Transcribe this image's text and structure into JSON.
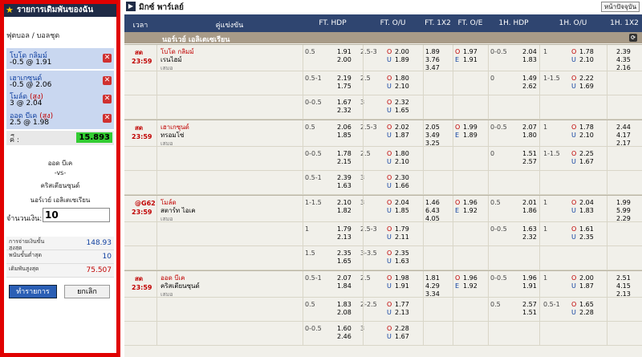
{
  "slip": {
    "header": "รายการเดิมพันของฉัน",
    "bet_type": "ฟุตบอล / บอลชุด",
    "selections": [
      {
        "team": "โบโด กลิมม์",
        "side": "",
        "odds_text": "-0.5 @ 1.91"
      },
      {
        "team": "เฮาเกซุนด์",
        "side": "",
        "odds_text": "-0.5 @ 2.06"
      },
      {
        "team": "โมล์ด",
        "side": "(สูง)",
        "odds_text": "3 @ 2.04"
      },
      {
        "team": "ออด บีเค",
        "side": "(สูง)",
        "odds_text": "2.5 @ 1.98"
      }
    ],
    "total_label": "ค่ี :",
    "total_value": "15.893",
    "match_home": "ออด บีเค",
    "match_vs": "-vs-",
    "match_away": "คริสเตียนซุนด์",
    "match_league": "นอร์เวย์ เอลิเตเซเรียน",
    "stake_label": "จำนวนเงิน:",
    "stake_value": "10",
    "info": [
      {
        "label": "การจ่ายเงินขั้นสูงสุด",
        "value": "148.93"
      },
      {
        "label": "พนันขั้นต่ำสุด",
        "value": "10"
      },
      {
        "label": "เดิมพันสูงสุด",
        "value": "75.507"
      }
    ],
    "submit_label": "ทำรายการ",
    "cancel_label": "ยกเลิก"
  },
  "main": {
    "title": "มิกซ์ พาร์เลย์",
    "today_button": "หน้าปัจจุบัน",
    "headers": [
      "เวลา",
      "คู่แข่งขัน",
      "FT. HDP",
      "FT. O/U",
      "FT. 1X2",
      "FT. O/E",
      "1H. HDP",
      "1H. O/U",
      "1H. 1X2"
    ],
    "league": "นอร์เวย์ เอลิเตเซเรียน",
    "matches": [
      {
        "status": "สด",
        "time": "23:59",
        "home": "โบโด กลิมม์",
        "away": "เรนไฮม์",
        "draw": "เสมอ",
        "home_fav": true,
        "lines": [
          {
            "ft_hdp": "0.5",
            "ft_hdp_h": "1.91",
            "ft_hdp_a": "2.00",
            "ft_ou": "2.5-3",
            "ft_o": "2.00",
            "ft_u": "1.89",
            "x1": "1.89",
            "x2": "3.76",
            "xx": "3.47",
            "oe_o": "1.97",
            "oe_e": "1.91",
            "h1_hdp": "0-0.5",
            "h1_hdp_h": "2.04",
            "h1_hdp_a": "1.83",
            "h1_ou": "1",
            "h1_o": "1.78",
            "h1_u": "2.10",
            "h1_1": "2.39",
            "h1_2": "4.35",
            "h1_x": "2.16"
          },
          {
            "ft_hdp": "0.5-1",
            "ft_hdp_h": "2.19",
            "ft_hdp_a": "1.75",
            "ft_ou": "2.5",
            "ft_o": "1.80",
            "ft_u": "2.10",
            "x1": "",
            "x2": "",
            "xx": "",
            "oe_o": "",
            "oe_e": "",
            "h1_hdp": "0",
            "h1_hdp_h": "1.49",
            "h1_hdp_a": "2.62",
            "h1_ou": "1-1.5",
            "h1_o": "2.22",
            "h1_u": "1.69",
            "h1_1": "",
            "h1_2": "",
            "h1_x": ""
          },
          {
            "ft_hdp": "0-0.5",
            "ft_hdp_h": "1.67",
            "ft_hdp_a": "2.32",
            "ft_ou": "3",
            "ft_o": "2.32",
            "ft_u": "1.65",
            "x1": "",
            "x2": "",
            "xx": "",
            "oe_o": "",
            "oe_e": "",
            "h1_hdp": "",
            "h1_hdp_h": "",
            "h1_hdp_a": "",
            "h1_ou": "",
            "h1_o": "",
            "h1_u": "",
            "h1_1": "",
            "h1_2": "",
            "h1_x": ""
          }
        ]
      },
      {
        "status": "สด",
        "time": "23:59",
        "home": "เฮาเกซุนด์",
        "away": "ทรอมโซ่",
        "draw": "เสมอ",
        "home_fav": true,
        "lines": [
          {
            "ft_hdp": "0.5",
            "ft_hdp_h": "2.06",
            "ft_hdp_a": "1.85",
            "ft_ou": "2.5-3",
            "ft_o": "2.02",
            "ft_u": "1.87",
            "x1": "2.05",
            "x2": "3.49",
            "xx": "3.25",
            "oe_o": "1.99",
            "oe_e": "1.89",
            "h1_hdp": "0-0.5",
            "h1_hdp_h": "2.07",
            "h1_hdp_a": "1.80",
            "h1_ou": "1",
            "h1_o": "1.78",
            "h1_u": "2.10",
            "h1_1": "2.44",
            "h1_2": "4.17",
            "h1_x": "2.17"
          },
          {
            "ft_hdp": "0-0.5",
            "ft_hdp_h": "1.78",
            "ft_hdp_a": "2.15",
            "ft_ou": "2.5",
            "ft_o": "1.80",
            "ft_u": "2.10",
            "x1": "",
            "x2": "",
            "xx": "",
            "oe_o": "",
            "oe_e": "",
            "h1_hdp": "0",
            "h1_hdp_h": "1.51",
            "h1_hdp_a": "2.57",
            "h1_ou": "1-1.5",
            "h1_o": "2.25",
            "h1_u": "1.67",
            "h1_1": "",
            "h1_2": "",
            "h1_x": ""
          },
          {
            "ft_hdp": "0.5-1",
            "ft_hdp_h": "2.39",
            "ft_hdp_a": "1.63",
            "ft_ou": "3",
            "ft_o": "2.30",
            "ft_u": "1.66",
            "x1": "",
            "x2": "",
            "xx": "",
            "oe_o": "",
            "oe_e": "",
            "h1_hdp": "",
            "h1_hdp_h": "",
            "h1_hdp_a": "",
            "h1_ou": "",
            "h1_o": "",
            "h1_u": "",
            "h1_1": "",
            "h1_2": "",
            "h1_x": ""
          }
        ]
      },
      {
        "status": "@G62",
        "time": "23:59",
        "home": "โมล์ด",
        "away": "สตาร์ท ไอเค",
        "draw": "เสมอ",
        "home_fav": true,
        "lines": [
          {
            "ft_hdp": "1-1.5",
            "ft_hdp_h": "2.10",
            "ft_hdp_a": "1.82",
            "ft_ou": "3",
            "ft_o": "2.04",
            "ft_u": "1.85",
            "x1": "1.46",
            "x2": "6.43",
            "xx": "4.05",
            "oe_o": "1.96",
            "oe_e": "1.92",
            "h1_hdp": "0.5",
            "h1_hdp_h": "2.01",
            "h1_hdp_a": "1.86",
            "h1_ou": "1",
            "h1_o": "2.04",
            "h1_u": "1.83",
            "h1_1": "1.99",
            "h1_2": "5.99",
            "h1_x": "2.29"
          },
          {
            "ft_hdp": "1",
            "ft_hdp_h": "1.79",
            "ft_hdp_a": "2.13",
            "ft_ou": "2.5-3",
            "ft_o": "1.79",
            "ft_u": "2.11",
            "x1": "",
            "x2": "",
            "xx": "",
            "oe_o": "",
            "oe_e": "",
            "h1_hdp": "0-0.5",
            "h1_hdp_h": "1.63",
            "h1_hdp_a": "2.32",
            "h1_ou": "1",
            "h1_o": "1.61",
            "h1_u": "2.35",
            "h1_1": "",
            "h1_2": "",
            "h1_x": ""
          },
          {
            "ft_hdp": "1.5",
            "ft_hdp_h": "2.35",
            "ft_hdp_a": "1.65",
            "ft_ou": "3-3.5",
            "ft_o": "2.35",
            "ft_u": "1.63",
            "x1": "",
            "x2": "",
            "xx": "",
            "oe_o": "",
            "oe_e": "",
            "h1_hdp": "",
            "h1_hdp_h": "",
            "h1_hdp_a": "",
            "h1_ou": "",
            "h1_o": "",
            "h1_u": "",
            "h1_1": "",
            "h1_2": "",
            "h1_x": ""
          }
        ]
      },
      {
        "status": "สด",
        "time": "23:59",
        "home": "ออด บีเค",
        "away": "คริสเตียนซุนด์",
        "draw": "เสมอ",
        "home_fav": true,
        "lines": [
          {
            "ft_hdp": "0.5-1",
            "ft_hdp_h": "2.07",
            "ft_hdp_a": "1.84",
            "ft_ou": "2.5",
            "ft_o": "1.98",
            "ft_u": "1.91",
            "x1": "1.81",
            "x2": "4.29",
            "xx": "3.34",
            "oe_o": "1.96",
            "oe_e": "1.92",
            "h1_hdp": "0-0.5",
            "h1_hdp_h": "1.96",
            "h1_hdp_a": "1.91",
            "h1_ou": "1",
            "h1_o": "2.00",
            "h1_u": "1.87",
            "h1_1": "2.51",
            "h1_2": "4.15",
            "h1_x": "2.13"
          },
          {
            "ft_hdp": "0.5",
            "ft_hdp_h": "1.83",
            "ft_hdp_a": "2.08",
            "ft_ou": "2-2.5",
            "ft_o": "1.77",
            "ft_u": "2.13",
            "x1": "",
            "x2": "",
            "xx": "",
            "oe_o": "",
            "oe_e": "",
            "h1_hdp": "0.5",
            "h1_hdp_h": "2.57",
            "h1_hdp_a": "1.51",
            "h1_ou": "0.5-1",
            "h1_o": "1.65",
            "h1_u": "2.28",
            "h1_1": "",
            "h1_2": "",
            "h1_x": ""
          },
          {
            "ft_hdp": "0-0.5",
            "ft_hdp_h": "1.60",
            "ft_hdp_a": "2.46",
            "ft_ou": "3",
            "ft_o": "2.28",
            "ft_u": "1.67",
            "x1": "",
            "x2": "",
            "xx": "",
            "oe_o": "",
            "oe_e": "",
            "h1_hdp": "",
            "h1_hdp_h": "",
            "h1_hdp_a": "",
            "h1_ou": "",
            "h1_o": "",
            "h1_u": "",
            "h1_1": "",
            "h1_2": "",
            "h1_x": ""
          }
        ]
      }
    ]
  }
}
